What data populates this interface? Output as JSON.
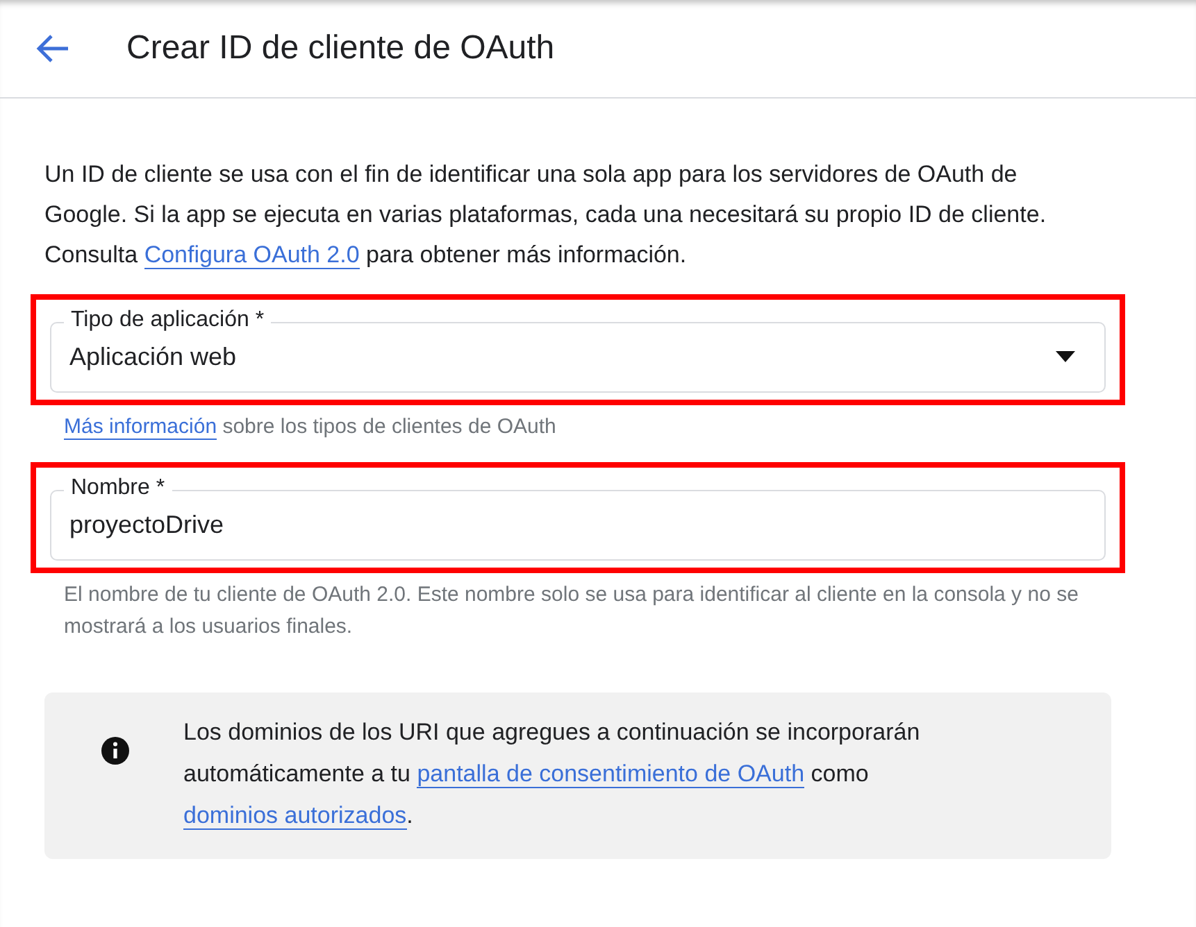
{
  "header": {
    "title": "Crear ID de cliente de OAuth"
  },
  "intro": [
    {
      "kind": "text",
      "text": "Un ID de cliente se usa con el fin de identificar una sola app para los servidores de OAuth de Google. Si la app se ejecuta en varias plataformas, cada una necesitará su propio ID de cliente. Consulta "
    },
    {
      "kind": "link",
      "text": "Configura OAuth 2.0"
    },
    {
      "kind": "text",
      "text": " para obtener más información."
    }
  ],
  "fields": [
    {
      "kind": "select",
      "label": "Tipo de aplicación *",
      "value": "Aplicación web",
      "highlighted": true,
      "help": [
        {
          "kind": "link",
          "text": "Más información"
        },
        {
          "kind": "text",
          "text": " sobre los tipos de clientes de OAuth"
        }
      ]
    },
    {
      "kind": "text",
      "label": "Nombre *",
      "value": "proyectoDrive",
      "highlighted": true,
      "help": [
        {
          "kind": "text",
          "text": "El nombre de tu cliente de OAuth 2.0. Este nombre solo se usa para identificar al cliente en la consola y no se mostrará a los usuarios finales."
        }
      ]
    }
  ],
  "notice": [
    {
      "kind": "text",
      "text": "Los dominios de los URI que agregues a continuación se incorporarán automáticamente a tu "
    },
    {
      "kind": "link",
      "text": "pantalla de consentimiento de OAuth"
    },
    {
      "kind": "text",
      "text": " como "
    },
    {
      "kind": "link",
      "text": "dominios autorizados"
    },
    {
      "kind": "text",
      "text": "."
    }
  ]
}
